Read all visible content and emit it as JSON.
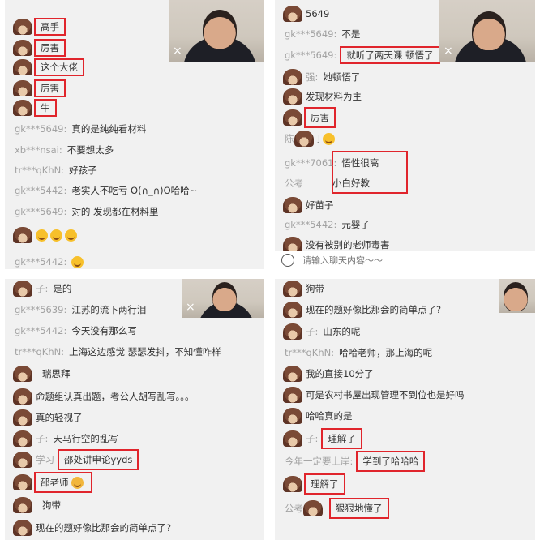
{
  "panel1": {
    "messages": [
      {
        "nick": "",
        "text": "高手",
        "avatar": true
      },
      {
        "nick": "",
        "text": "厉害",
        "avatar": true
      },
      {
        "nick": "",
        "text": "这个大佬",
        "avatar": true
      },
      {
        "nick": "",
        "text": "厉害",
        "avatar": true
      },
      {
        "nick": "",
        "text": "牛",
        "avatar": true
      },
      {
        "nick": "gk***5649:",
        "text": "真的是纯纯看材料"
      },
      {
        "nick": "xb***nsai:",
        "text": "不要想太多"
      },
      {
        "nick": "tr***qKhN:",
        "text": "好孩子"
      },
      {
        "nick": "gk***5442:",
        "text": "老实人不吃亏 O(∩_∩)O哈哈~"
      },
      {
        "nick": "gk***5649:",
        "text": "对的 发现都在材料里"
      },
      {
        "nick": "gk***5442:",
        "text": ""
      }
    ],
    "close": "×"
  },
  "panel2": {
    "messages": [
      {
        "nick": "",
        "text": "5649",
        "avatar": true
      },
      {
        "nick": "gk***5649:",
        "text": "不是"
      },
      {
        "nick": "gk***5649:",
        "text": "就听了两天课 顿悟了"
      },
      {
        "nick": "强:",
        "text": "她顿悟了",
        "avatar": true
      },
      {
        "nick": "",
        "text": "发现材料为主",
        "avatar": true
      },
      {
        "nick": "",
        "text": "厉害",
        "avatar": true
      },
      {
        "nick": "陈",
        "text": "]",
        "avatar": true
      },
      {
        "nick": "gk***7061:",
        "text": "悟性很高"
      },
      {
        "nick": "公考",
        "text": "小白好教"
      },
      {
        "nick": "",
        "text": "好苗子",
        "avatar": true
      },
      {
        "nick": "gk***5442:",
        "text": "元婴了"
      },
      {
        "nick": "",
        "text": "没有被别的老师毒害",
        "avatar": true
      }
    ],
    "input_placeholder": "请输入聊天内容～～",
    "close": "×"
  },
  "panel3": {
    "messages": [
      {
        "nick": "子:",
        "text": "是的",
        "avatar": true
      },
      {
        "nick": "gk***5639:",
        "text": "江苏的流下两行泪"
      },
      {
        "nick": "gk***5442:",
        "text": "今天没有那么写"
      },
      {
        "nick": "tr***qKhN:",
        "text": "上海这边感觉 瑟瑟发抖，不知懂咋样"
      },
      {
        "nick": "",
        "text": "瑞思拜",
        "avatar": true
      },
      {
        "nick": "",
        "text": "命题组认真出题，考公人胡写乱写。。。",
        "avatar": true
      },
      {
        "nick": "",
        "text": "真的轻视了",
        "avatar": true
      },
      {
        "nick": "子:",
        "text": "天马行空的乱写",
        "avatar": true
      },
      {
        "nick": "学习",
        "text": "邵处讲申论yyds",
        "avatar": true
      },
      {
        "nick": "",
        "text": "邵老师",
        "avatar": true
      },
      {
        "nick": "",
        "text": "狗带",
        "avatar": true
      },
      {
        "nick": "",
        "text": "现在的题好像比那会的简单点了?",
        "avatar": true
      }
    ],
    "close": "×"
  },
  "panel4": {
    "messages": [
      {
        "nick": "",
        "text": "狗带",
        "avatar": true
      },
      {
        "nick": "",
        "text": "现在的题好像比那会的简单点了?",
        "avatar": true
      },
      {
        "nick": "子:",
        "text": "山东的呢",
        "avatar": true
      },
      {
        "nick": "tr***qKhN:",
        "text": "哈哈老师，那上海的呢"
      },
      {
        "nick": "",
        "text": "我的直接10分了",
        "avatar": true
      },
      {
        "nick": "",
        "text": "可是农村书屋出现管理不到位也是好吗",
        "avatar": true
      },
      {
        "nick": "",
        "text": "哈哈真的是",
        "avatar": true
      },
      {
        "nick": "子:",
        "text": "理解了",
        "avatar": true
      },
      {
        "nick": "今年一定要上岸:",
        "text": "学到了哈哈哈"
      },
      {
        "nick": "",
        "text": "理解了",
        "avatar": true
      },
      {
        "nick": "公考",
        "text": "狠狠地懂了",
        "avatar": true
      }
    ],
    "close": "×"
  }
}
